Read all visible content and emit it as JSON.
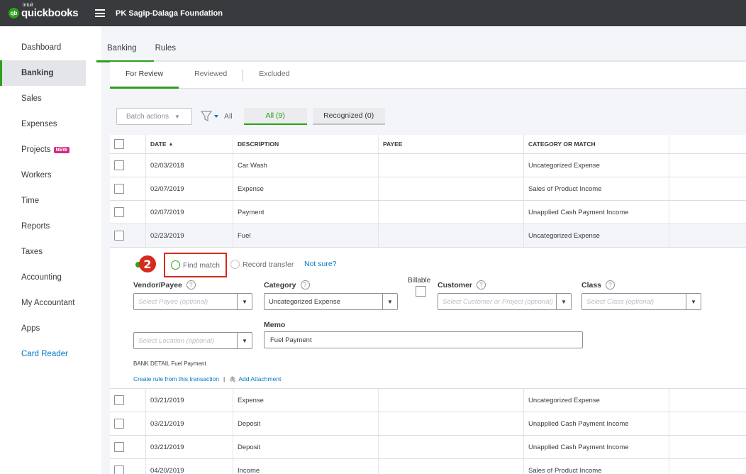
{
  "topbar": {
    "logo_intuit": "intuit",
    "logo_text": "quickbooks",
    "company": "PK Sagip-Dalaga Foundation"
  },
  "sidebar": {
    "items": [
      {
        "label": "Dashboard"
      },
      {
        "label": "Banking"
      },
      {
        "label": "Sales"
      },
      {
        "label": "Expenses"
      },
      {
        "label": "Projects",
        "badge": "NEW"
      },
      {
        "label": "Workers"
      },
      {
        "label": "Time"
      },
      {
        "label": "Reports"
      },
      {
        "label": "Taxes"
      },
      {
        "label": "Accounting"
      },
      {
        "label": "My Accountant"
      },
      {
        "label": "Apps"
      },
      {
        "label": "Card Reader"
      }
    ]
  },
  "tabs": {
    "banking": "Banking",
    "rules": "Rules"
  },
  "subtabs": {
    "for_review": "For Review",
    "reviewed": "Reviewed",
    "excluded": "Excluded"
  },
  "toolbar": {
    "batch_actions": "Batch actions",
    "all_label": "All",
    "all_count": "All (9)",
    "recognized_count": "Recognized (0)"
  },
  "table": {
    "headers": {
      "date": "DATE",
      "description": "DESCRIPTION",
      "payee": "PAYEE",
      "category": "CATEGORY OR MATCH"
    },
    "rows_top": [
      {
        "date": "02/03/2018",
        "description": "Car Wash",
        "payee": "",
        "category": "Uncategorized Expense"
      },
      {
        "date": "02/07/2019",
        "description": "Expense",
        "payee": "",
        "category": "Sales of Product Income"
      },
      {
        "date": "02/07/2019",
        "description": "Payment",
        "payee": "",
        "category": "Unapplied Cash Payment Income"
      },
      {
        "date": "02/23/2019",
        "description": "Fuel",
        "payee": "",
        "category": "Uncategorized Expense"
      }
    ],
    "rows_bottom": [
      {
        "date": "03/21/2019",
        "description": "Expense",
        "payee": "",
        "category": "Uncategorized Expense"
      },
      {
        "date": "03/21/2019",
        "description": "Deposit",
        "payee": "",
        "category": "Unapplied Cash Payment Income"
      },
      {
        "date": "03/21/2019",
        "description": "Deposit",
        "payee": "",
        "category": "Unapplied Cash Payment Income"
      },
      {
        "date": "04/20/2019",
        "description": "Income",
        "payee": "",
        "category": "Sales of Product Income"
      }
    ]
  },
  "expanded": {
    "step_number": "2",
    "find_match": "Find match",
    "record_transfer": "Record transfer",
    "not_sure": "Not sure?",
    "vendor_label": "Vendor/Payee",
    "vendor_placeholder": "Select Payee (optional)",
    "category_label": "Category",
    "category_value": "Uncategorized Expense",
    "billable_label": "Billable",
    "customer_label": "Customer",
    "customer_placeholder": "Select Customer or Project (optional)",
    "class_label": "Class",
    "class_placeholder": "Select Class (optional)",
    "location_placeholder": "Select Location (optional)",
    "memo_label": "Memo",
    "memo_value": "Fuel Payment",
    "bank_detail": "BANK DETAIL Fuel Payment",
    "create_rule": "Create rule from this transaction",
    "add_attachment": "Add Attachment"
  },
  "colors": {
    "brand_green": "#2ca01c",
    "topbar": "#393a3d",
    "link_blue": "#0077c5",
    "highlight_red": "#d52b1e"
  }
}
